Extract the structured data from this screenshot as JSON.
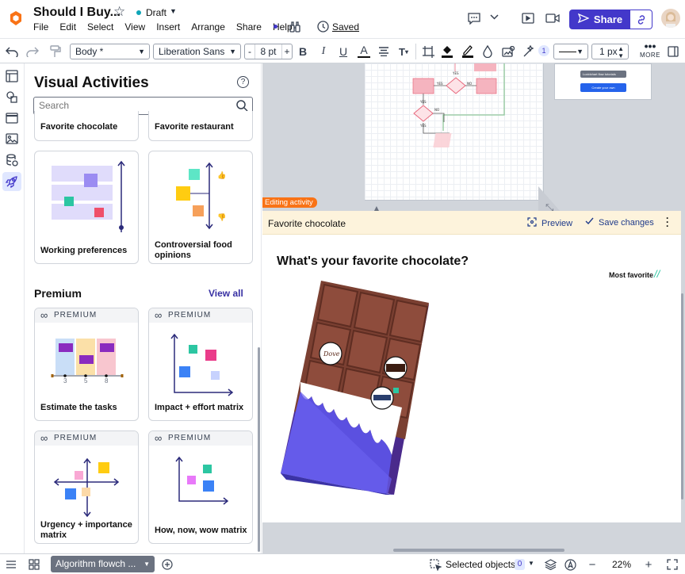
{
  "doc": {
    "title": "Should I Buy...",
    "status": "Draft",
    "saved": "Saved"
  },
  "menu": [
    "File",
    "Edit",
    "Select",
    "View",
    "Insert",
    "Arrange",
    "Share",
    "Help"
  ],
  "share_label": "Share",
  "toolbar": {
    "style": "Body *",
    "font": "Liberation Sans",
    "font_size": "8 pt",
    "minus": "-",
    "plus": "+",
    "bold": "B",
    "italic": "I",
    "underline": "U",
    "text_color": "A",
    "badge": "1",
    "line_width": "1 px",
    "more": "MORE"
  },
  "panel": {
    "title": "Visual Activities",
    "search_placeholder": "Search",
    "cards_top": [
      "Favorite chocolate",
      "Favorite restaurant"
    ],
    "cards_mid": [
      "Working preferences",
      "Controversial food opinions"
    ],
    "premium_heading": "Premium",
    "view_all": "View all",
    "premium_tag": "PREMIUM",
    "premium_cards": [
      "Estimate the tasks",
      "Impact + effort matrix",
      "Urgency + importance matrix",
      "How, now, wow matrix"
    ],
    "estimate_ticks": [
      "3",
      "5",
      "8"
    ]
  },
  "canvas": {
    "editing_tag": "Editing activity",
    "activity_name": "Favorite chocolate",
    "preview": "Preview",
    "save_changes": "Save changes",
    "question": "What's your favorite chocolate?",
    "most_favorite": "Most favorite",
    "flow_labels": {
      "yes": "YES",
      "no": "NO"
    },
    "mini_button": "Create your own",
    "mini_link": "Lucidchart flow tutorials"
  },
  "status": {
    "page_tab": "Algorithm flowch ...",
    "selected_objects": "Selected objects",
    "selected_count": "0",
    "zoom": "22%",
    "minus": "−",
    "plus": "+"
  },
  "colors": {
    "accent": "#3b37c9",
    "share_bg": "#4338ca",
    "editing": "#f97316",
    "chocolate": "#7b4032",
    "wrapper": "#5b50e0"
  }
}
